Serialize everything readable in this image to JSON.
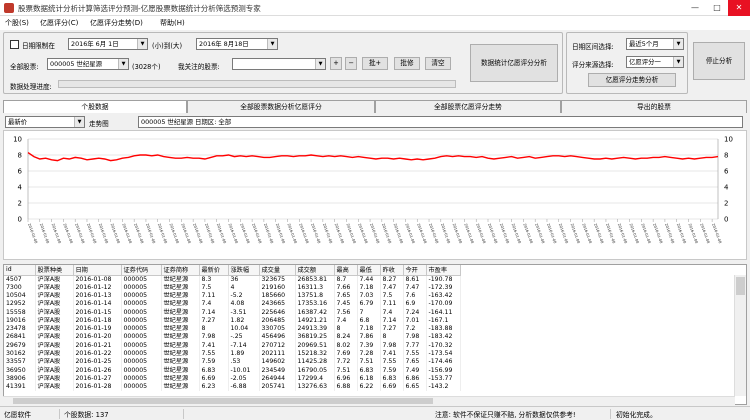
{
  "window": {
    "title": "股票数据统计分析计算筛选评分预测-亿愿股票数据统计分析筛选预测专家",
    "minimize": "—",
    "maximize": "□",
    "close": "✕"
  },
  "menu": [
    "个股(S)",
    "亿愿评分(C)",
    "亿愿评分走势(D)",
    "帮助(H)"
  ],
  "controls": {
    "date_limit_label": "日期限制在",
    "date_from": "2016年 6月 1日",
    "to_label": "(小)到(大)",
    "date_to": "2016年 8月18日",
    "all_stocks_label": "全部股票:",
    "stock_select": "000005  世纪星源",
    "stock_count": "(3028个)",
    "watch_label": "我关注的股票:",
    "watch_value": "",
    "plus": "+",
    "minus": "−",
    "batch_add": "批+",
    "batch_edit": "批修",
    "clear": "清空",
    "analyze_btn": "数据统计亿愿评分分析",
    "progress_label": "数据处理进度:",
    "date_range_label": "日期区间选择:",
    "date_range_value": "最近5个月",
    "score_src_label": "评分来源选择:",
    "score_src_value": "亿愿评分一",
    "trend_btn": "亿愿评分走势分析",
    "stop_btn": "停止分析"
  },
  "tabs": [
    "个股数据",
    "全部股票数据分析亿愿评分",
    "全部股票亿愿评分走势",
    "导出的股票"
  ],
  "chart_controls": {
    "metric": "最新价",
    "trend_label": "走势图",
    "info": "000005  世纪星源   日期区: 全部"
  },
  "chart_data": {
    "type": "line",
    "yticks": [
      0,
      2,
      4,
      6,
      8,
      10
    ],
    "ylim": [
      0,
      10
    ],
    "xlabels_sample": "2016-01-08",
    "values": [
      8.3,
      7.8,
      7.5,
      7.6,
      7.4,
      7.3,
      7.6,
      7.5,
      7.7,
      7.6,
      7.4,
      7.5,
      7.6,
      7.5,
      7.3,
      7.4,
      7.6,
      7.7,
      7.9,
      8.0,
      8.0,
      7.9,
      8.0,
      7.8,
      7.7,
      7.6,
      7.6,
      7.7,
      7.6,
      7.6,
      7.5,
      7.7,
      7.9,
      7.9,
      8.0,
      7.8,
      7.9,
      7.8,
      7.9,
      7.8,
      7.7,
      7.7,
      7.8,
      7.9,
      7.9,
      7.8,
      7.9,
      7.9,
      8.0,
      7.9,
      7.8,
      7.9,
      7.8,
      7.9,
      7.8,
      7.7,
      7.8,
      7.7,
      7.6,
      7.5,
      7.6,
      7.6,
      7.5,
      7.6,
      7.5,
      7.4,
      7.5,
      7.4,
      7.5,
      7.6,
      7.8,
      7.9,
      7.8,
      7.9,
      7.8,
      7.8,
      7.7,
      7.8,
      7.6,
      7.5,
      7.6,
      7.7,
      7.8,
      7.6,
      7.7,
      7.8,
      7.6,
      7.7,
      7.8,
      7.9,
      7.9,
      7.8,
      7.9,
      7.8,
      7.7,
      7.6,
      7.5,
      7.5,
      7.6,
      7.5,
      7.6,
      7.7,
      7.6,
      7.5,
      7.6,
      7.6,
      7.7,
      7.7,
      7.8,
      7.7,
      7.6,
      7.5,
      7.6,
      7.5,
      7.6,
      7.7,
      7.7,
      7.8
    ],
    "line_color": "#ff0000"
  },
  "table": {
    "headers": [
      "id",
      "股票种类",
      "日期",
      "证券代码",
      "证券简称",
      "最新价",
      "涨跌幅",
      "成交量",
      "成交额",
      "最高",
      "最低",
      "昨收",
      "今开",
      "市盈率"
    ],
    "rows": [
      [
        "4507",
        "沪深A股",
        "2016-01-08",
        "000005",
        "世纪星源",
        "8.3",
        "36",
        "323675",
        "26853.81",
        "8.7",
        "7.44",
        "8.27",
        "8.61",
        "-190.78"
      ],
      [
        "7300",
        "沪深A股",
        "2016-01-12",
        "000005",
        "世纪星源",
        "7.5",
        "4",
        "219160",
        "16311.3",
        "7.66",
        "7.18",
        "7.47",
        "7.47",
        "-172.39"
      ],
      [
        "10504",
        "沪深A股",
        "2016-01-13",
        "000005",
        "世纪星源",
        "7.11",
        "-5.2",
        "185660",
        "13751.8",
        "7.65",
        "7.03",
        "7.5",
        "7.6",
        "-163.42"
      ],
      [
        "12952",
        "沪深A股",
        "2016-01-14",
        "000005",
        "世纪星源",
        "7.4",
        "4.08",
        "243665",
        "17353.16",
        "7.45",
        "6.79",
        "7.11",
        "6.9",
        "-170.09"
      ],
      [
        "15558",
        "沪深A股",
        "2016-01-15",
        "000005",
        "世纪星源",
        "7.14",
        "-3.51",
        "225646",
        "16387.42",
        "7.56",
        "7",
        "7.4",
        "7.24",
        "-164.11"
      ],
      [
        "19016",
        "沪深A股",
        "2016-01-18",
        "000005",
        "世纪星源",
        "7.27",
        "1.82",
        "206485",
        "14921.21",
        "7.4",
        "6.8",
        "7.14",
        "7.01",
        "-167.1"
      ],
      [
        "23478",
        "沪深A股",
        "2016-01-19",
        "000005",
        "世纪星源",
        "8",
        "10.04",
        "330705",
        "24913.39",
        "8",
        "7.18",
        "7.27",
        "7.2",
        "-183.88"
      ],
      [
        "26841",
        "沪深A股",
        "2016-01-20",
        "000005",
        "世纪星源",
        "7.98",
        "-.25",
        "456496",
        "36819.25",
        "8.24",
        "7.86",
        "8",
        "7.98",
        "-183.42"
      ],
      [
        "29679",
        "沪深A股",
        "2016-01-21",
        "000005",
        "世纪星源",
        "7.41",
        "-7.14",
        "270712",
        "20969.51",
        "8.02",
        "7.39",
        "7.98",
        "7.77",
        "-170.32"
      ],
      [
        "30162",
        "沪深A股",
        "2016-01-22",
        "000005",
        "世纪星源",
        "7.55",
        "1.89",
        "202111",
        "15218.32",
        "7.69",
        "7.28",
        "7.41",
        "7.55",
        "-173.54"
      ],
      [
        "33557",
        "沪深A股",
        "2016-01-25",
        "000005",
        "世纪星源",
        "7.59",
        ".53",
        "149602",
        "11425.28",
        "7.72",
        "7.51",
        "7.55",
        "7.65",
        "-174.46"
      ],
      [
        "36950",
        "沪深A股",
        "2016-01-26",
        "000005",
        "世纪星源",
        "6.83",
        "-10.01",
        "234549",
        "16790.05",
        "7.51",
        "6.83",
        "7.59",
        "7.49",
        "-156.99"
      ],
      [
        "38906",
        "沪深A股",
        "2016-01-27",
        "000005",
        "世纪星源",
        "6.69",
        "-2.05",
        "264944",
        "17299.4",
        "6.96",
        "6.18",
        "6.83",
        "6.86",
        "-153.77"
      ],
      [
        "41391",
        "沪深A股",
        "2016-01-28",
        "000005",
        "世纪星源",
        "6.23",
        "-6.88",
        "205741",
        "13276.63",
        "6.88",
        "6.22",
        "6.69",
        "6.65",
        "-143.2"
      ]
    ]
  },
  "status": {
    "app": "亿愿软件",
    "count": "个股数据: 137",
    "notice": "注意: 软件不保证只赚不赔, 分析数据仅供参考!",
    "state": "初始化完成。"
  }
}
